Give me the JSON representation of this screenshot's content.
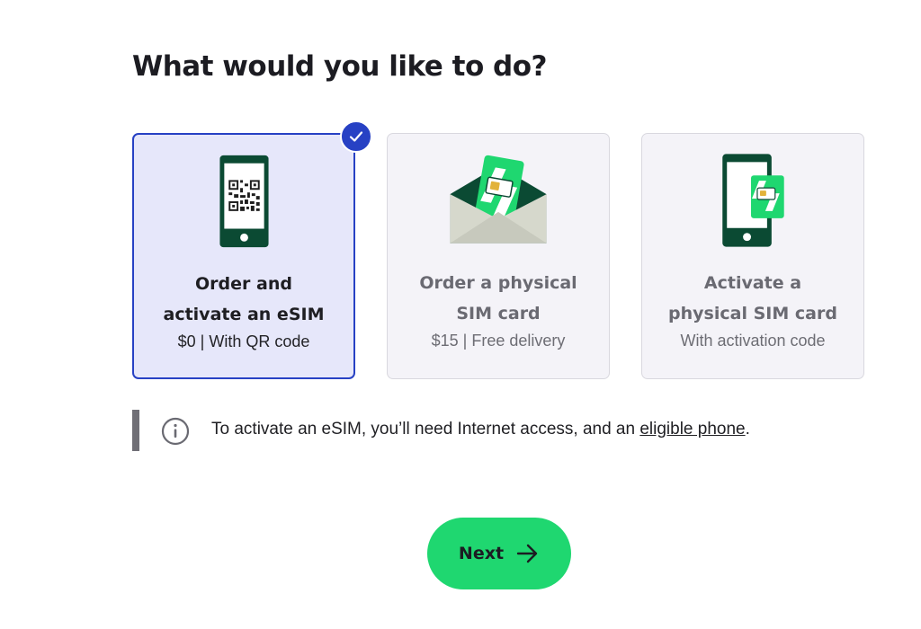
{
  "heading": "What would you like to do?",
  "options": [
    {
      "title": "Order and activate an eSIM",
      "subtitle": "$0 | With QR code",
      "selected": true
    },
    {
      "title": "Order a physical SIM card",
      "subtitle": "$15 | Free delivery",
      "selected": false
    },
    {
      "title": "Activate a physical SIM card",
      "subtitle": "With activation code",
      "selected": false
    }
  ],
  "notice": {
    "text_before": "To activate an eSIM, you’ll need Internet access, and an ",
    "link": "eligible phone",
    "text_after": "."
  },
  "next_button": {
    "label": "Next"
  },
  "colors": {
    "selected_border": "#2741c4",
    "selected_background": "#e6e7fa",
    "brand_green": "#1fd770",
    "dark_green": "#0b4a33"
  }
}
